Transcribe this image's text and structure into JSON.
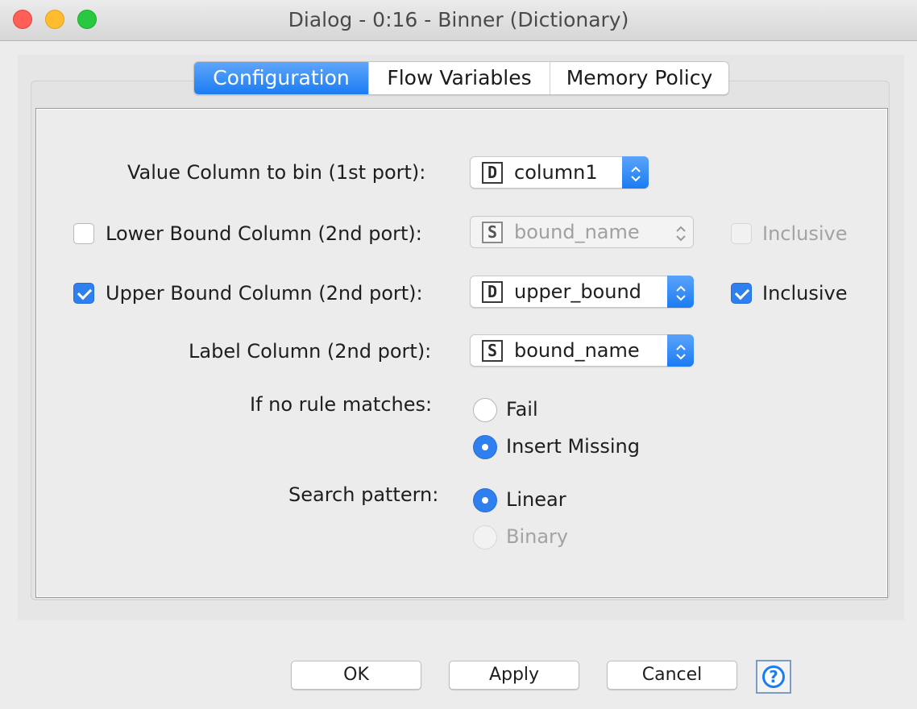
{
  "window": {
    "title": "Dialog - 0:16 - Binner (Dictionary)"
  },
  "tabs": [
    {
      "label": "Configuration",
      "active": true
    },
    {
      "label": "Flow Variables",
      "active": false
    },
    {
      "label": "Memory Policy",
      "active": false
    }
  ],
  "form": {
    "value_column": {
      "label": "Value Column to bin (1st port):",
      "type_icon": "D",
      "value": "column1"
    },
    "lower_bound": {
      "label": "Lower Bound Column (2nd port):",
      "checked": false,
      "type_icon": "S",
      "value": "bound_name",
      "enabled": false,
      "inclusive_label": "Inclusive",
      "inclusive_checked": false
    },
    "upper_bound": {
      "label": "Upper Bound Column (2nd port):",
      "checked": true,
      "type_icon": "D",
      "value": "upper_bound",
      "enabled": true,
      "inclusive_label": "Inclusive",
      "inclusive_checked": true
    },
    "label_column": {
      "label": "Label Column (2nd port):",
      "type_icon": "S",
      "value": "bound_name"
    },
    "no_rule": {
      "label": "If no rule matches:",
      "options": [
        {
          "label": "Fail",
          "selected": false,
          "enabled": true
        },
        {
          "label": "Insert Missing",
          "selected": true,
          "enabled": true
        }
      ]
    },
    "search_pattern": {
      "label": "Search pattern:",
      "options": [
        {
          "label": "Linear",
          "selected": true,
          "enabled": true
        },
        {
          "label": "Binary",
          "selected": false,
          "enabled": false
        }
      ]
    }
  },
  "buttons": {
    "ok": "OK",
    "apply": "Apply",
    "cancel": "Cancel",
    "help_icon": "help-icon"
  },
  "colors": {
    "accent": "#1b7cf3",
    "close": "#ff5f57",
    "minimize": "#febc2e",
    "maximize": "#28c840"
  }
}
